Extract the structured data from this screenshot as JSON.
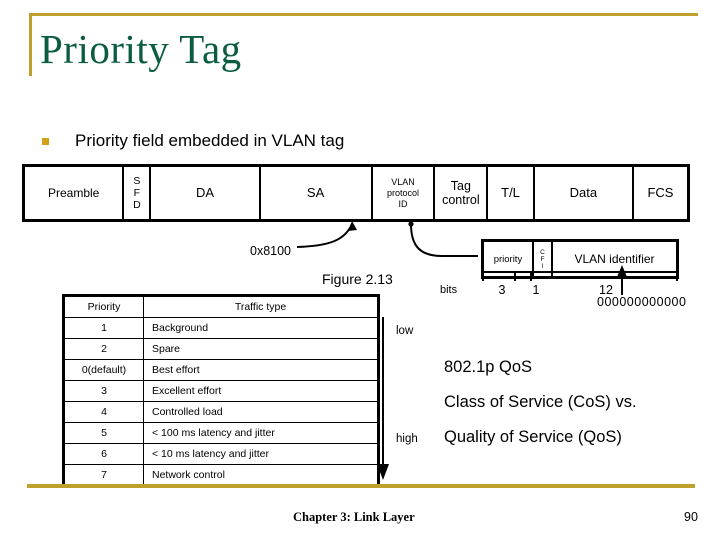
{
  "slide": {
    "title": "Priority Tag",
    "title_color": "#0b5c40",
    "accent_color": "#bfa02c",
    "bullet_color": "#d4a017",
    "background": "#ffffff"
  },
  "bullet": {
    "marker": "square-bullet",
    "text": "Priority field embedded in VLAN tag"
  },
  "frame_diagram": {
    "cells": [
      {
        "label": "Preamble",
        "style": "normal",
        "width_pct": 15.0
      },
      {
        "label": "S\nF\nD",
        "style": "stack",
        "width_pct": 4.1
      },
      {
        "label": "DA",
        "style": "big",
        "width_pct": 16.5
      },
      {
        "label": "SA",
        "style": "big",
        "width_pct": 16.9
      },
      {
        "label": "VLAN\nprotocol\nID",
        "style": "stack",
        "width_pct": 9.5
      },
      {
        "label": "Tag\ncontrol",
        "style": "big-stack",
        "width_pct": 8.0
      },
      {
        "label": "T/L",
        "style": "big",
        "width_pct": 7.0
      },
      {
        "label": "Data",
        "style": "big",
        "width_pct": 15.0
      },
      {
        "label": "FCS",
        "style": "big",
        "width_pct": 8.0
      }
    ]
  },
  "annotations": {
    "ethertype_hex": "0x8100",
    "figure_caption": "Figure 2.13"
  },
  "tag_control_detail": {
    "cells": [
      {
        "label": "priority",
        "id": "priority",
        "bits": "3"
      },
      {
        "label": "C\nF\nI",
        "id": "cfi",
        "bits": "1"
      },
      {
        "label": "VLAN identifier",
        "id": "vlan-identifier",
        "bits": "12"
      }
    ],
    "bits_axis_label": "bits",
    "vlan_identifier_value": "000000000000"
  },
  "priority_table": {
    "headers": [
      "Priority",
      "Traffic type"
    ],
    "rows": [
      {
        "priority": "1",
        "traffic_type": "Background"
      },
      {
        "priority": "2",
        "traffic_type": "Spare"
      },
      {
        "priority": "0(default)",
        "traffic_type": "Best effort"
      },
      {
        "priority": "3",
        "traffic_type": "Excellent effort"
      },
      {
        "priority": "4",
        "traffic_type": "Controlled load"
      },
      {
        "priority": "5",
        "traffic_type": "< 100 ms latency and jitter"
      },
      {
        "priority": "6",
        "traffic_type": "< 10 ms latency and jitter"
      },
      {
        "priority": "7",
        "traffic_type": "Network control"
      }
    ],
    "arrow_top_label": "low",
    "arrow_bottom_label": "high"
  },
  "right_text": {
    "line1": "802.1p QoS",
    "line2": "Class of Service (CoS) vs.",
    "line3": "Quality of Service (QoS)"
  },
  "footer": {
    "title": "Chapter 3: Link Layer",
    "page_number": "90"
  }
}
